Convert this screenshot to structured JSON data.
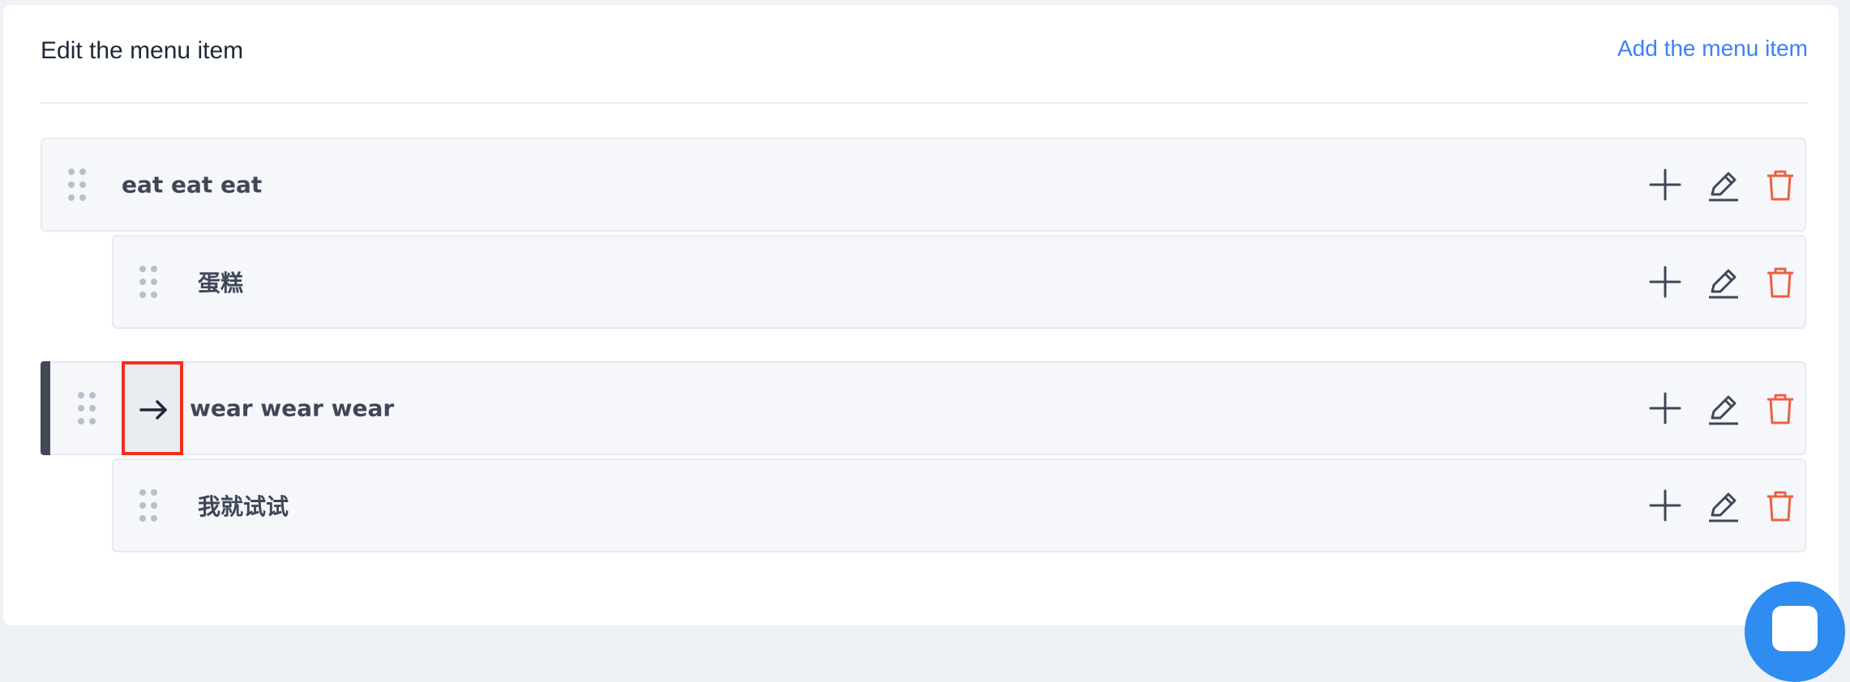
{
  "header": {
    "title": "Edit the menu item",
    "add_label": "Add the menu item"
  },
  "menu": {
    "items": [
      {
        "label": "eat eat eat",
        "level": 0
      },
      {
        "label": "蛋糕",
        "level": 1
      },
      {
        "label": "wear wear wear",
        "level": 0,
        "selected": true
      },
      {
        "label": "我就试试",
        "level": 1
      }
    ]
  },
  "icons": {
    "drag": "drag-handle-icon",
    "add": "plus-icon",
    "edit": "pencil-icon",
    "delete": "trash-icon",
    "indent": "arrow-right-icon"
  },
  "colors": {
    "accent": "#3b82f6",
    "danger": "#ee6040",
    "text": "#3f4756",
    "row_bg": "#f5f7fb",
    "highlight": "#f0301e",
    "fab": "#2f8cf0"
  }
}
